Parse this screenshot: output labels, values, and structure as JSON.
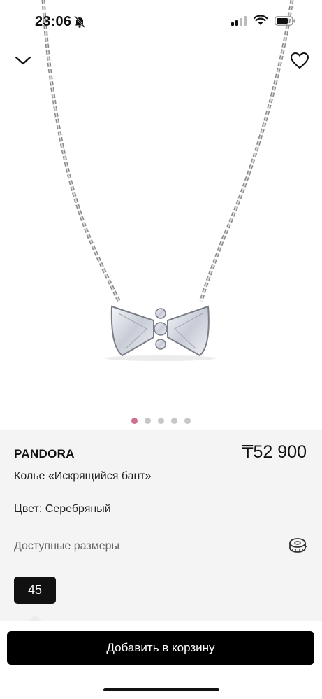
{
  "status_bar": {
    "time": "23:06"
  },
  "product": {
    "brand": "PANDORA",
    "price": "₸52 900",
    "name": "Колье «Искрящийся бант»",
    "color_line": "Цвет: Серебряный",
    "sizes_label": "Доступные размеры",
    "selected_size": "45"
  },
  "gallery": {
    "image_count": 5,
    "active_index": 0
  },
  "cart": {
    "add_label": "Добавить в корзину"
  },
  "colors": {
    "active_dot": "#d26f8c",
    "info_bg": "#f4f4f4",
    "button_bg": "#000000"
  }
}
